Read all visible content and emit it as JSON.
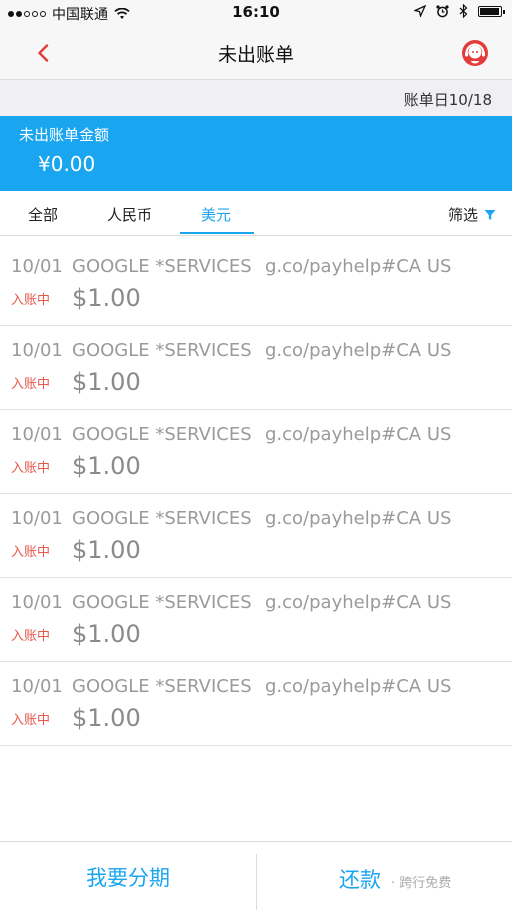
{
  "status_bar": {
    "carrier": "中国联通",
    "time": "16:10"
  },
  "nav": {
    "title": "未出账单"
  },
  "bill_date": "账单日10/18",
  "summary": {
    "label": "未出账单金额",
    "amount": "¥0.00"
  },
  "tabs": [
    {
      "label": "全部"
    },
    {
      "label": "人民币"
    },
    {
      "label": "美元"
    }
  ],
  "active_tab": "美元",
  "filter_label": "筛选",
  "transactions": [
    {
      "date": "10/01",
      "merchant": "GOOGLE *SERVICES",
      "ref": "g.co/payhelp#CA US",
      "status": "入账中",
      "amount": "$1.00"
    },
    {
      "date": "10/01",
      "merchant": "GOOGLE *SERVICES",
      "ref": "g.co/payhelp#CA US",
      "status": "入账中",
      "amount": "$1.00"
    },
    {
      "date": "10/01",
      "merchant": "GOOGLE *SERVICES",
      "ref": "g.co/payhelp#CA US",
      "status": "入账中",
      "amount": "$1.00"
    },
    {
      "date": "10/01",
      "merchant": "GOOGLE *SERVICES",
      "ref": "g.co/payhelp#CA US",
      "status": "入账中",
      "amount": "$1.00"
    },
    {
      "date": "10/01",
      "merchant": "GOOGLE *SERVICES",
      "ref": "g.co/payhelp#CA US",
      "status": "入账中",
      "amount": "$1.00"
    },
    {
      "date": "10/01",
      "merchant": "GOOGLE *SERVICES",
      "ref": "g.co/payhelp#CA US",
      "status": "入账中",
      "amount": "$1.00"
    }
  ],
  "bottom": {
    "installment_label": "我要分期",
    "repay_label": "还款",
    "repay_note": "· 跨行免费"
  },
  "colors": {
    "accent": "#1aa5f0",
    "status_red": "#e8584a",
    "back_arrow": "#e33a3a"
  },
  "icons": [
    "wifi-icon",
    "location-icon",
    "alarm-icon",
    "bluetooth-icon",
    "battery-icon",
    "back-arrow-icon",
    "customer-service-icon",
    "filter-icon"
  ]
}
